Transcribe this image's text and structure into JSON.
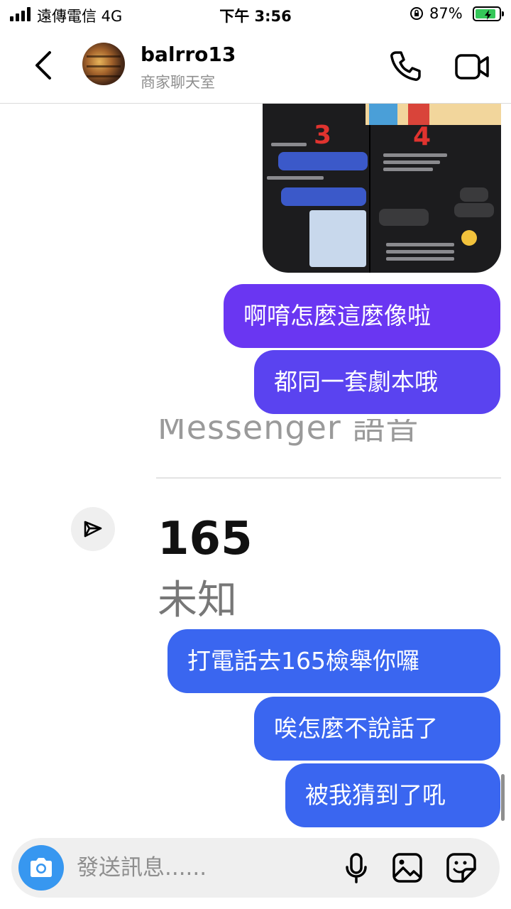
{
  "status_bar": {
    "carrier": "遠傳電信  4G",
    "time": "下午 3:56",
    "battery_percent": "87%",
    "battery_level": 0.87,
    "icons": [
      "signal-icon",
      "orientation-lock-icon",
      "battery-charging-icon"
    ]
  },
  "header": {
    "username": "balrro13",
    "subtitle": "商家聊天室",
    "icons": [
      "back-icon",
      "avatar",
      "phone-icon",
      "video-camera-icon"
    ]
  },
  "shared_image": {
    "panel_numbers": [
      "3",
      "4"
    ]
  },
  "messages": {
    "m1": "啊唷怎麼這麼像啦",
    "m2": "都同一套劇本哦",
    "m3": "打電話去165檢舉你囉",
    "m4": "唉怎麼不說話了",
    "m5": "被我猜到了吼"
  },
  "link_preview": {
    "cut_text": "Messenger 語音",
    "title": "165",
    "subtitle": "未知"
  },
  "composer": {
    "placeholder": "發送訊息......",
    "icons": [
      "camera-icon",
      "microphone-icon",
      "gallery-icon",
      "sticker-icon"
    ]
  },
  "colors": {
    "bubble_purple": "#6a36f2",
    "bubble_violet": "#5a43f0",
    "bubble_blue": "#3a66f0",
    "camera_blue": "#3797f0"
  }
}
